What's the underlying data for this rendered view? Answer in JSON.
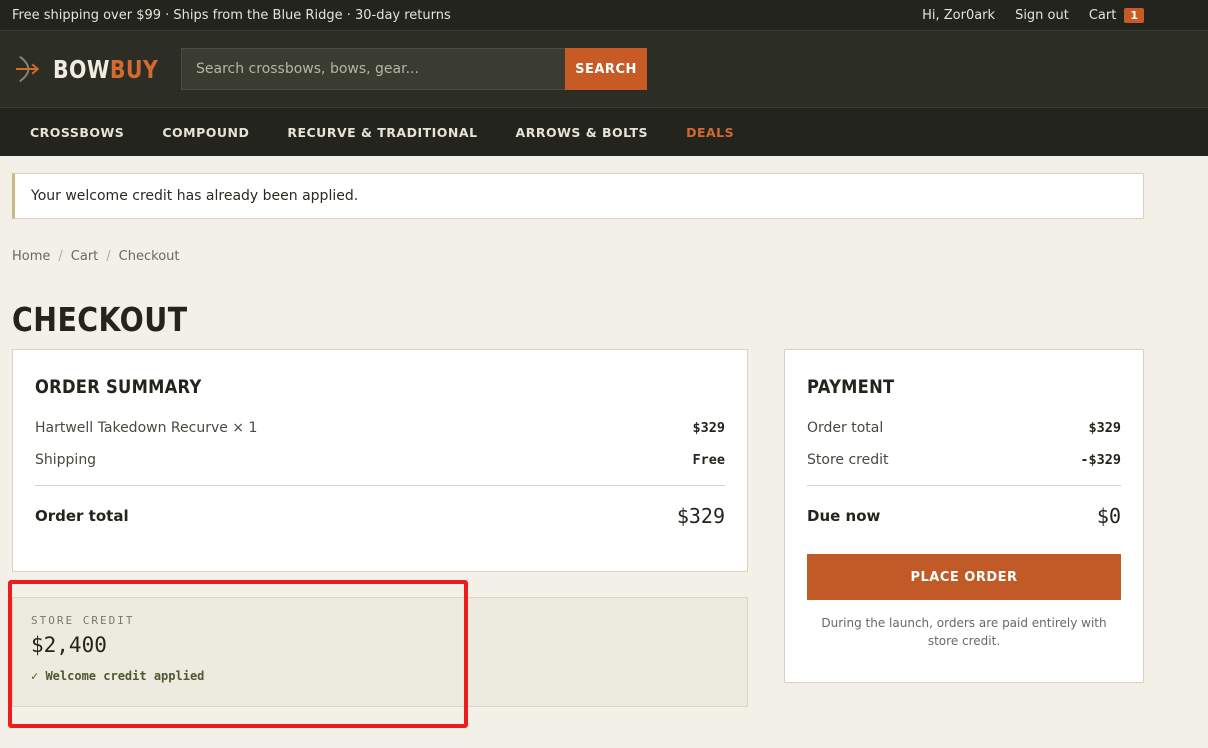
{
  "topbar": {
    "promo": "Free shipping over $99 · Ships from the Blue Ridge · 30-day returns",
    "greeting": "Hi, Zor0ark",
    "signout": "Sign out",
    "cart_label": "Cart",
    "cart_count": "1"
  },
  "header": {
    "logo_part1": "BOW",
    "logo_part2": "BUY",
    "search_placeholder": "Search crossbows, bows, gear...",
    "search_button": "SEARCH"
  },
  "nav": {
    "items": [
      "CROSSBOWS",
      "COMPOUND",
      "RECURVE & TRADITIONAL",
      "ARROWS & BOLTS",
      "DEALS"
    ]
  },
  "notice": "Your welcome credit has already been applied.",
  "breadcrumb": [
    "Home",
    "Cart",
    "Checkout"
  ],
  "page_title": "CHECKOUT",
  "summary": {
    "heading": "ORDER SUMMARY",
    "item_label": "Hartwell Takedown Recurve × 1",
    "item_price": "$329",
    "shipping_label": "Shipping",
    "shipping_value": "Free",
    "total_label": "Order total",
    "total_value": "$329"
  },
  "credit": {
    "label": "STORE CREDIT",
    "amount": "$2,400",
    "status": "✓ Welcome credit applied"
  },
  "payment": {
    "heading": "PAYMENT",
    "order_total_label": "Order total",
    "order_total_value": "$329",
    "credit_label": "Store credit",
    "credit_value": "-$329",
    "due_label": "Due now",
    "due_value": "$0",
    "button": "PLACE ORDER",
    "note": "During the launch, orders are paid entirely with store credit."
  },
  "colors": {
    "accent": "#c75a25",
    "dark": "#23241d",
    "highlight": "#ee1c1c"
  }
}
